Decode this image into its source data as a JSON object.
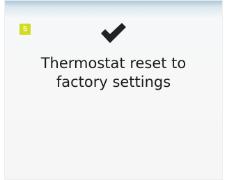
{
  "step": {
    "number": "5",
    "color": "#d2dc1e"
  },
  "status_icon": "checkmark-icon",
  "message": "Thermostat reset to\nfactory settings"
}
